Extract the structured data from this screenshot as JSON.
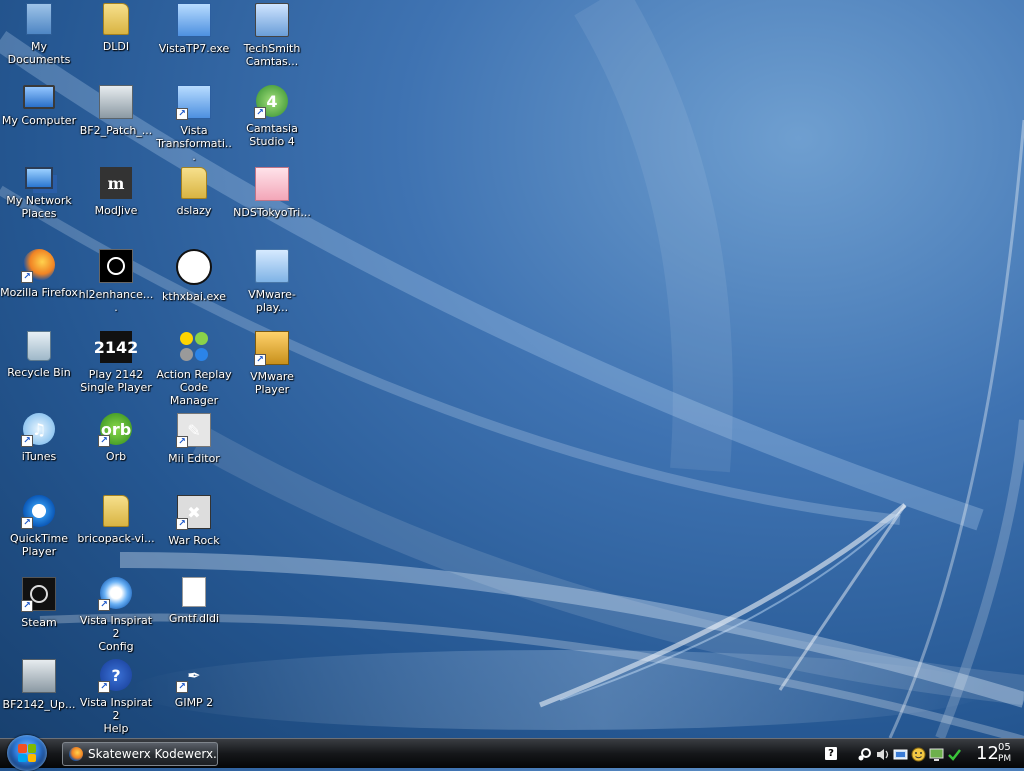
{
  "desktop": {
    "icons": [
      {
        "id": "my-documents",
        "label": "My Documents",
        "glyph": "doc"
      },
      {
        "id": "my-computer",
        "label": "My Computer",
        "glyph": "monitor"
      },
      {
        "id": "my-network-places",
        "label": "My Network\nPlaces",
        "glyph": "network"
      },
      {
        "id": "mozilla-firefox",
        "label": "Mozilla Firefox",
        "glyph": "firefox",
        "shortcut": true
      },
      {
        "id": "recycle-bin",
        "label": "Recycle Bin",
        "glyph": "bin"
      },
      {
        "id": "itunes",
        "label": "iTunes",
        "glyph": "itunes",
        "shortcut": true
      },
      {
        "id": "quicktime-player",
        "label": "QuickTime\nPlayer",
        "glyph": "qt",
        "shortcut": true
      },
      {
        "id": "steam",
        "label": "Steam",
        "glyph": "steam",
        "shortcut": true
      },
      {
        "id": "bf2142-update",
        "label": "BF2142_Up...",
        "glyph": "bf"
      },
      {
        "id": "dldi",
        "label": "DLDI",
        "glyph": "folder"
      },
      {
        "id": "bf2-patch",
        "label": "BF2_Patch_...",
        "glyph": "bf"
      },
      {
        "id": "modjive",
        "label": "ModJive",
        "glyph": "modjive"
      },
      {
        "id": "hl2enhance",
        "label": "hl2enhance....",
        "glyph": "hl2"
      },
      {
        "id": "play-2142",
        "label": "Play 2142\nSingle Player",
        "glyph": "2142"
      },
      {
        "id": "orb",
        "label": "Orb",
        "glyph": "orb",
        "shortcut": true
      },
      {
        "id": "bricopack",
        "label": "bricopack-vi...",
        "glyph": "folder"
      },
      {
        "id": "vista-inspirat-config",
        "label": "Vista Inspirat 2\nConfig",
        "glyph": "vista2",
        "shortcut": true
      },
      {
        "id": "vista-inspirat-help",
        "label": "Vista Inspirat 2\nHelp",
        "glyph": "help",
        "shortcut": true
      },
      {
        "id": "vistatp7",
        "label": "VistaTP7.exe",
        "glyph": "installer"
      },
      {
        "id": "vista-transformation",
        "label": "Vista\nTransformati...",
        "glyph": "installer",
        "shortcut": true
      },
      {
        "id": "dslazy",
        "label": "dslazy",
        "glyph": "folder"
      },
      {
        "id": "kthxbai",
        "label": "kthxbai.exe",
        "glyph": "kthx"
      },
      {
        "id": "action-replay",
        "label": "Action Replay\nCode Manager",
        "glyph": "ar"
      },
      {
        "id": "mii-editor",
        "label": "Mii Editor",
        "glyph": "mii",
        "shortcut": true
      },
      {
        "id": "war-rock",
        "label": "War Rock",
        "glyph": "warrock",
        "shortcut": true
      },
      {
        "id": "gmtf-dldi",
        "label": "Gmtf.dldi",
        "glyph": "file"
      },
      {
        "id": "gimp-2",
        "label": "GIMP 2",
        "glyph": "gimp",
        "shortcut": true
      },
      {
        "id": "techsmith-camtasia",
        "label": "TechSmith\nCamtas...",
        "glyph": "techsmith"
      },
      {
        "id": "camtasia-studio-4",
        "label": "Camtasia\nStudio 4",
        "glyph": "camtasia",
        "shortcut": true
      },
      {
        "id": "ndstokyotri",
        "label": "NDSTokyoTri...",
        "glyph": "nds"
      },
      {
        "id": "vmware-player-setup",
        "label": "VMware-play...",
        "glyph": "vmplay"
      },
      {
        "id": "vmware-player",
        "label": "VMware Player",
        "glyph": "vmware",
        "shortcut": true
      }
    ]
  },
  "taskbar": {
    "task_button_label": "Skatewerx Kodewerx...",
    "help_icon": "?",
    "tray_icons": [
      "steam-icon",
      "volume-icon",
      "network-icon",
      "messenger-icon",
      "monitor-icon",
      "security-check-icon"
    ],
    "clock": {
      "hour": "12",
      "minute": "05",
      "ampm": "PM"
    }
  },
  "colors": {
    "accent": "#2f7ad8",
    "taskbar": "#15171a",
    "desktop": "#255792"
  }
}
